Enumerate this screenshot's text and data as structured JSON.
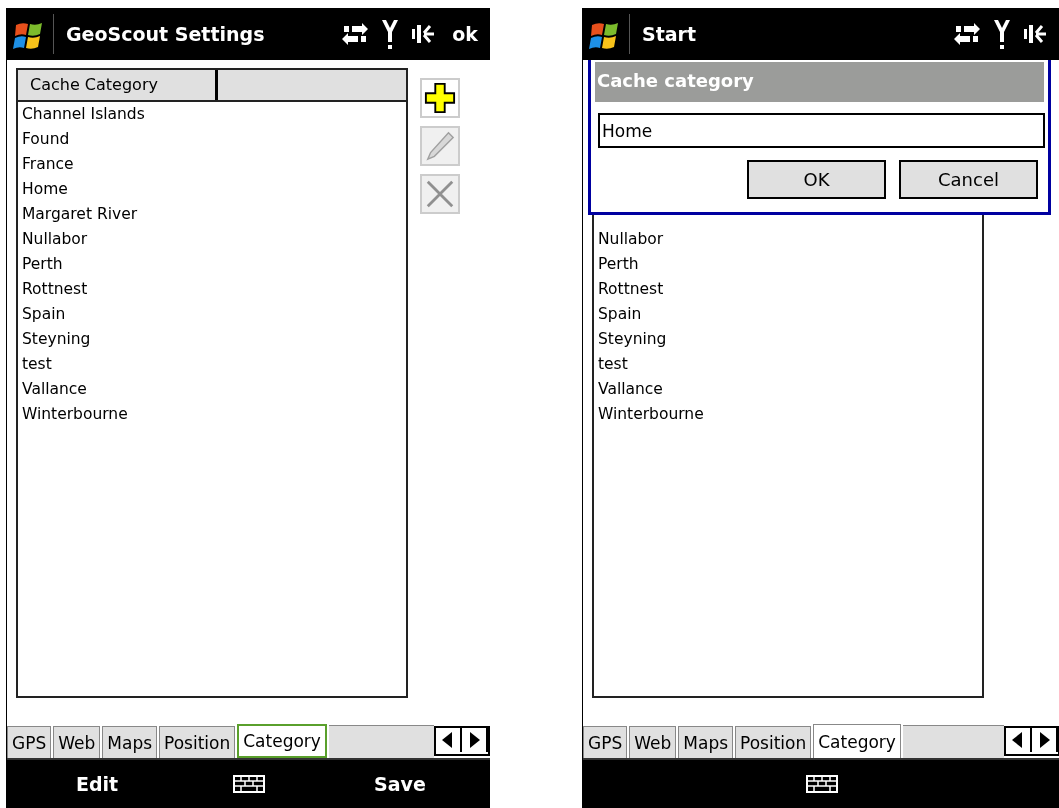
{
  "screens": [
    {
      "title": "GeoScout Settings",
      "ok_button": "ok",
      "list": {
        "columns": [
          "Cache Category"
        ],
        "items": [
          "Channel Islands",
          "Found",
          "France",
          "Home",
          "Margaret River",
          "Nullabor",
          "Perth",
          "Rottnest",
          "Spain",
          "Steyning",
          "test",
          "Vallance",
          "Winterbourne"
        ]
      },
      "side_buttons": [
        {
          "kind": "add",
          "disabled": false
        },
        {
          "kind": "edit",
          "disabled": true
        },
        {
          "kind": "delete",
          "disabled": true
        }
      ],
      "tabs": [
        {
          "label": "GPS",
          "selected": false,
          "focused": false
        },
        {
          "label": "Web",
          "selected": false,
          "focused": false
        },
        {
          "label": "Maps",
          "selected": false,
          "focused": false
        },
        {
          "label": "Position",
          "selected": false,
          "focused": false
        },
        {
          "label": "Category",
          "selected": true,
          "focused": true
        }
      ],
      "softkeys": {
        "left": "Edit",
        "right": "Save"
      }
    },
    {
      "title": "Start",
      "list": {
        "items": [
          "Nullabor",
          "Perth",
          "Rottnest",
          "Spain",
          "Steyning",
          "test",
          "Vallance",
          "Winterbourne"
        ]
      },
      "dialog": {
        "title": "Cache category",
        "value": "Home",
        "buttons": [
          "OK",
          "Cancel"
        ]
      },
      "tabs": [
        {
          "label": "GPS",
          "selected": false,
          "focused": false
        },
        {
          "label": "Web",
          "selected": false,
          "focused": false
        },
        {
          "label": "Maps",
          "selected": false,
          "focused": false
        },
        {
          "label": "Position",
          "selected": false,
          "focused": false
        },
        {
          "label": "Category",
          "selected": true,
          "focused": false
        }
      ]
    }
  ]
}
